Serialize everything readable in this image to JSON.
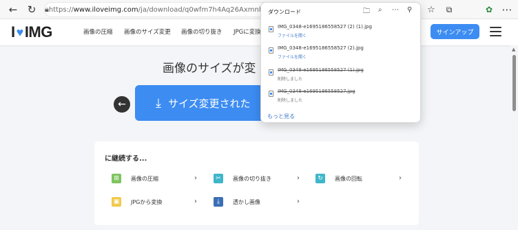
{
  "browser": {
    "url_prefix": "https://",
    "url_domain": "www.iloveimg.com",
    "url_path": "/ja/download/q0wfm7h4Aq26Axmnh5hl2Af"
  },
  "site": {
    "logo_left": "I",
    "logo_right": "IMG",
    "nav": [
      "画像の圧縮",
      "画像のサイズ変更",
      "画像の切り抜き",
      "JPGに変換"
    ],
    "signup_label": "サインアップ"
  },
  "main": {
    "title": "画像のサイズが変",
    "download_label": "サイズ変更された"
  },
  "continue": {
    "title": "に継続する...",
    "tools": [
      {
        "label": "画像の圧縮",
        "color": "#7ec45f",
        "glyph": "⊞"
      },
      {
        "label": "画像の切り抜き",
        "color": "#3fb6c9",
        "glyph": "✂"
      },
      {
        "label": "画像の回転",
        "color": "#3fb6c9",
        "glyph": "↻"
      },
      {
        "label": "JPGから変換",
        "color": "#f2c94c",
        "glyph": "▣"
      },
      {
        "label": "透かし画像",
        "color": "#3c6fb5",
        "glyph": "▼"
      }
    ]
  },
  "downloads": {
    "title": "ダウンロード",
    "items": [
      {
        "name": "IMG_0348-e1695186558527 (2) (1).jpg",
        "status": "ファイルを開く",
        "deleted": false
      },
      {
        "name": "IMG_0348-e1695186558527 (2).jpg",
        "status": "ファイルを開く",
        "deleted": false
      },
      {
        "name": "IMG_0348-e1695186558527 (1).jpg",
        "status": "削除しました",
        "deleted": true
      },
      {
        "name": "IMG_0348-e1695186558527.jpg",
        "status": "削除しました",
        "deleted": true
      }
    ],
    "more_label": "もっと見る"
  }
}
